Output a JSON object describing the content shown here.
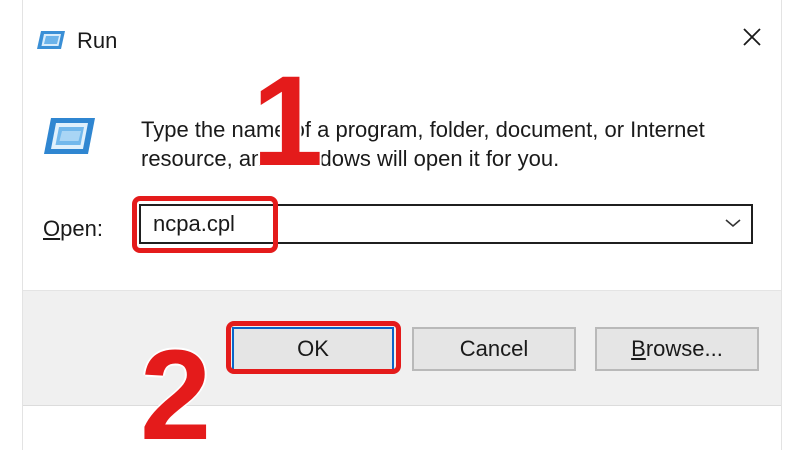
{
  "window": {
    "title": "Run",
    "title_icon": "run-icon",
    "close_icon": "close-icon"
  },
  "body": {
    "icon": "run-icon",
    "description": "Type the name of a program, folder, document, or Internet resource, and Windows will open it for you."
  },
  "open_field": {
    "label_accel": "O",
    "label_rest": "pen:",
    "value": "ncpa.cpl",
    "dropdown_icon": "chevron-down-icon"
  },
  "buttons": {
    "ok": "OK",
    "cancel": "Cancel",
    "browse_accel": "B",
    "browse_rest": "rowse..."
  },
  "annotations": {
    "step1": "1",
    "step2": "2",
    "highlight_color": "#e41b1b"
  },
  "colors": {
    "footer_bg": "#f0f0f0",
    "button_bg": "#e5e5e5",
    "default_button_border": "#0a64c8"
  }
}
